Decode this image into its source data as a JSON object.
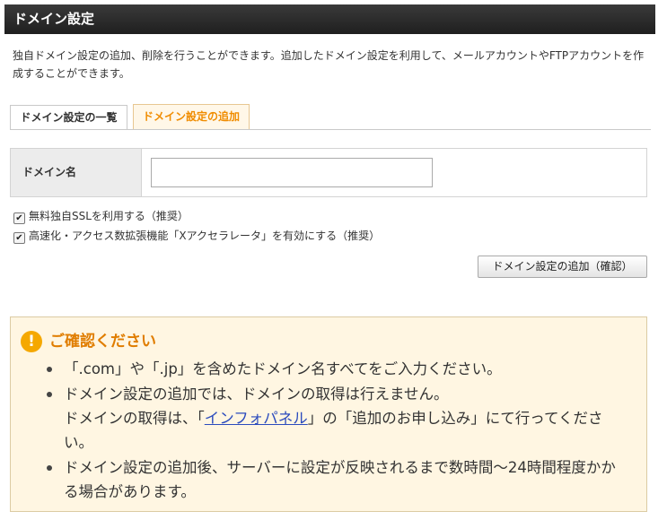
{
  "header": {
    "title": "ドメイン設定"
  },
  "description": "独自ドメイン設定の追加、削除を行うことができます。追加したドメイン設定を利用して、メールアカウントやFTPアカウントを作成することができます。",
  "tabs": [
    {
      "label": "ドメイン設定の一覧",
      "active": false
    },
    {
      "label": "ドメイン設定の追加",
      "active": true
    }
  ],
  "form": {
    "domain_label": "ドメイン名",
    "domain_value": "",
    "ssl_checkbox": {
      "label": "無料独自SSLを利用する（推奨）",
      "checked": true
    },
    "xaccel_checkbox": {
      "label": "高速化・アクセス数拡張機能「Xアクセラレータ」を有効にする（推奨）",
      "checked": true
    },
    "submit_label": "ドメイン設定の追加（確認）"
  },
  "notice": {
    "title": "ご確認ください",
    "item1": "「.com」や「.jp」を含めたドメイン名すべてをご入力ください。",
    "item2_line1": "ドメイン設定の追加では、ドメインの取得は行えません。",
    "item2_pre": "ドメインの取得は、「",
    "item2_link": "インフォパネル",
    "item2_post": "」の「追加のお申し込み」にて行ってください。",
    "item3": "ドメイン設定の追加後、サーバーに設定が反映されるまで数時間〜24時間程度かかる場合があります。"
  },
  "colors": {
    "accent": "#f08c00",
    "notice_bg": "#fff6e2",
    "header_bg": "#2b2b2b"
  }
}
